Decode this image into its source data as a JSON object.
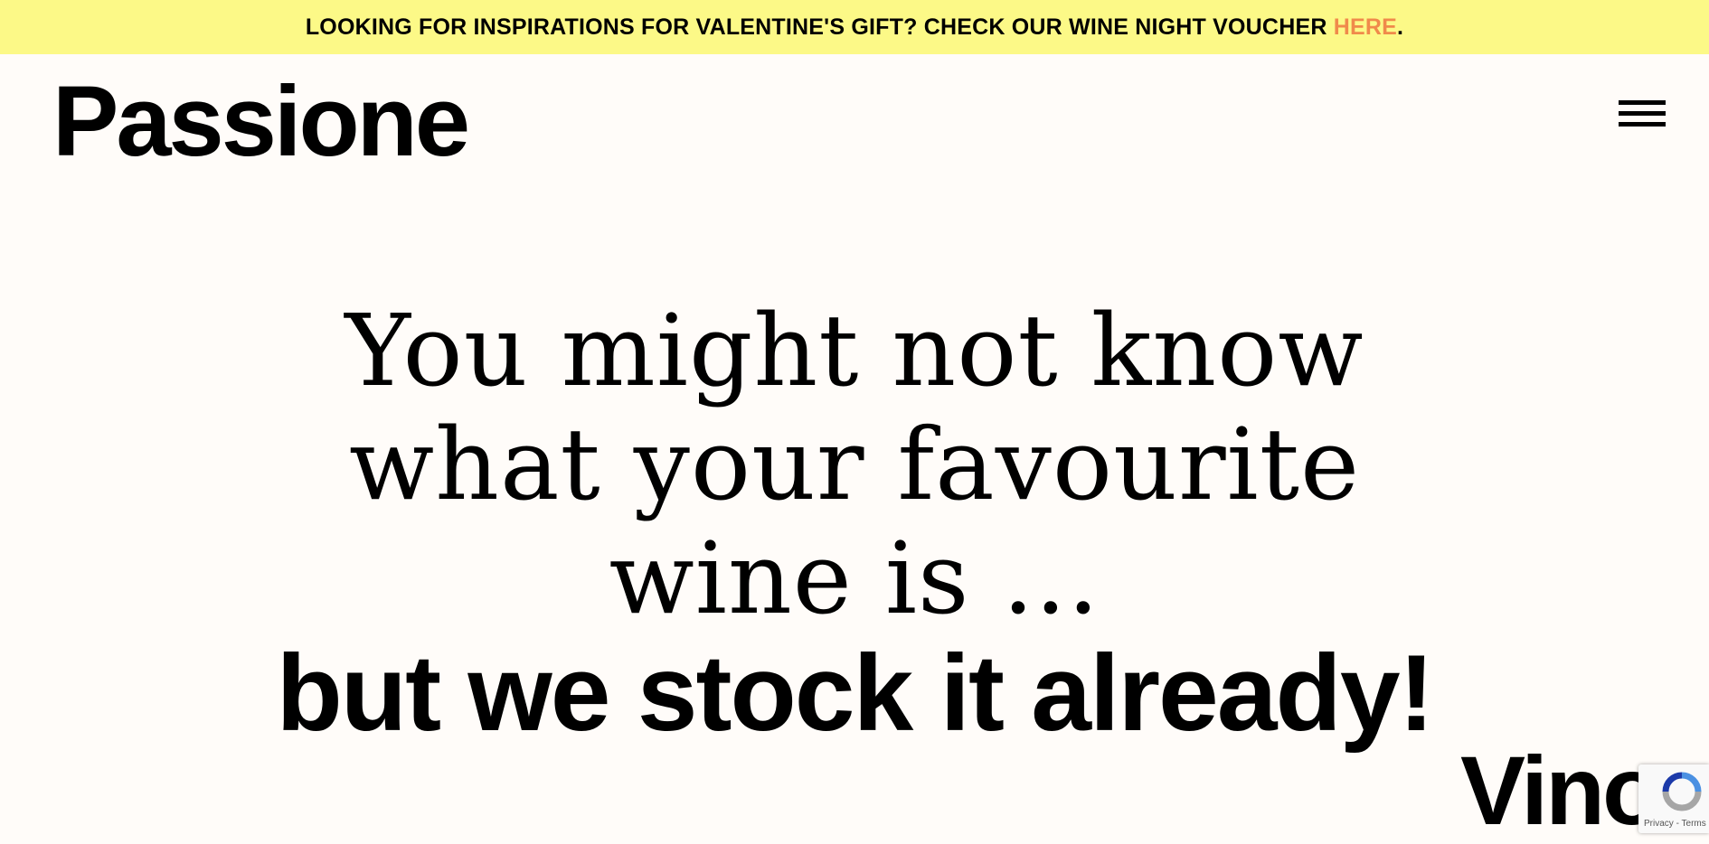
{
  "announcement": {
    "text": "LOOKING FOR INSPIRATIONS FOR VALENTINE'S GIFT? CHECK OUR WINE NIGHT VOUCHER ",
    "link_text": "HERE",
    "suffix": ".",
    "link_color": "#f08a4b",
    "background": "#fcf987"
  },
  "header": {
    "logo": "Passione",
    "menu_icon": "hamburger-menu-icon"
  },
  "hero": {
    "line1": "You might not know",
    "line2": "what your favourite",
    "line3": "wine is ...",
    "line4": "but we stock it already!"
  },
  "scroller": {
    "word": "Vino"
  },
  "recaptcha": {
    "icon": "recaptcha-icon",
    "privacy": "Privacy",
    "separator": " - ",
    "terms": "Terms"
  }
}
